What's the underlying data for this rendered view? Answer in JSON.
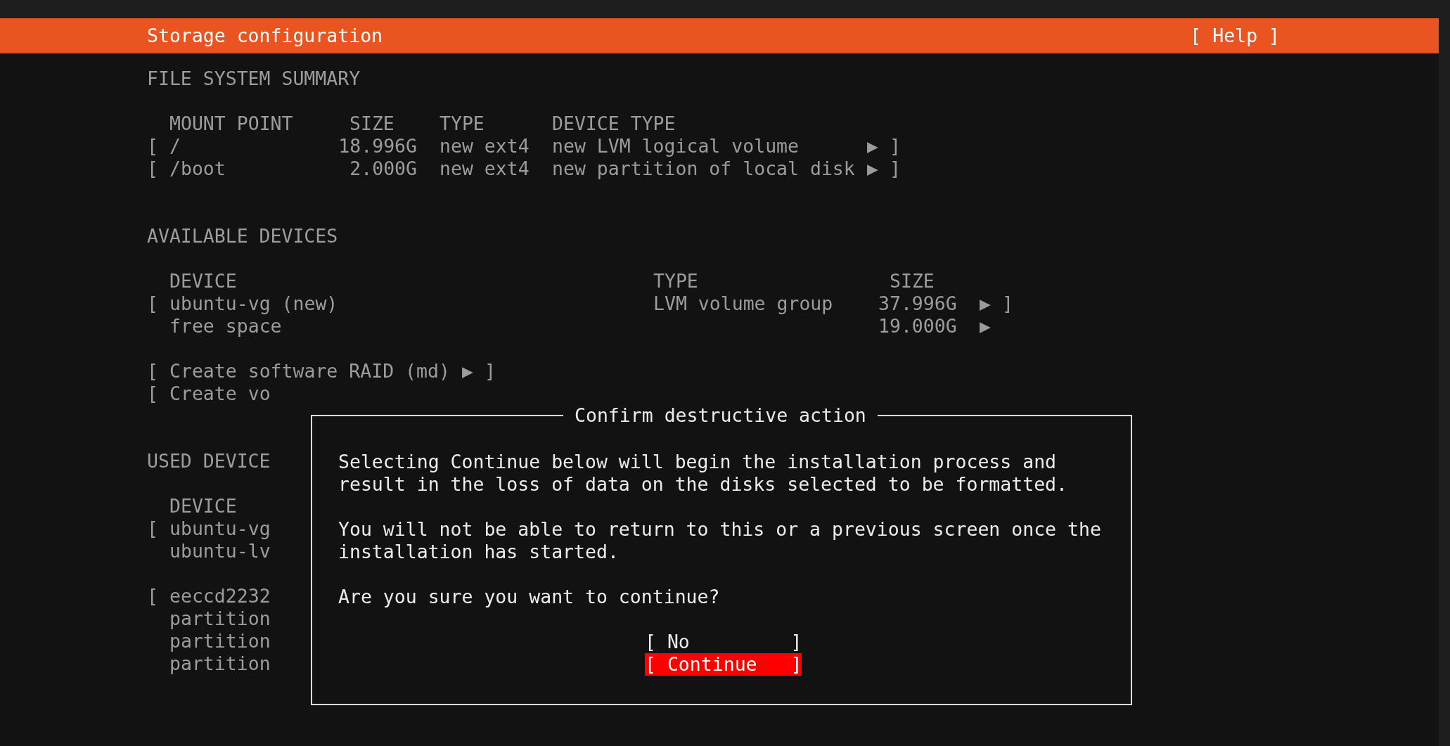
{
  "header": {
    "title": "Storage configuration",
    "help": "[ Help ]"
  },
  "file_system_summary": {
    "heading": "FILE SYSTEM SUMMARY",
    "columns": [
      "MOUNT POINT",
      "SIZE",
      "TYPE",
      "DEVICE TYPE"
    ],
    "rows": [
      {
        "open": "[",
        "mount_point": "/",
        "size": "18.996G",
        "type": "new ext4",
        "device_type": "new LVM logical volume",
        "arrow": "▶",
        "close": "]"
      },
      {
        "open": "[",
        "mount_point": "/boot",
        "size": "2.000G",
        "type": "new ext4",
        "device_type": "new partition of local disk",
        "arrow": "▶",
        "close": "]"
      }
    ]
  },
  "available_devices": {
    "heading": "AVAILABLE DEVICES",
    "columns": [
      "DEVICE",
      "TYPE",
      "SIZE"
    ],
    "rows": [
      {
        "open": "[",
        "device": "ubuntu-vg (new)",
        "type": "LVM volume group",
        "size": "37.996G",
        "arrow": "▶",
        "close": "]"
      },
      {
        "device": "free space",
        "size": "19.000G",
        "arrow": "▶"
      }
    ],
    "actions": [
      {
        "open": "[",
        "label": "Create software RAID (md)",
        "arrow": "▶",
        "close": "]"
      },
      {
        "open": "[",
        "label": "Create vo"
      }
    ]
  },
  "used_devices": {
    "heading": "USED DEVICE",
    "columns": [
      "DEVICE"
    ],
    "groups": [
      [
        {
          "open": "[",
          "device": "ubuntu-vg"
        },
        {
          "device": "ubuntu-lv"
        }
      ],
      [
        {
          "open": "[",
          "device": "eeccd2232"
        },
        {
          "device": "partition"
        },
        {
          "device": "partition"
        },
        {
          "device": "partition"
        }
      ]
    ]
  },
  "dialog": {
    "title": "Confirm destructive action",
    "paragraphs": [
      "Selecting Continue below will begin the installation process and result in the loss of data on the disks selected to be formatted.",
      "You will not be able to return to this or a previous screen once the installation has started.",
      "Are you sure you want to continue?"
    ],
    "buttons": [
      {
        "label": "[ No         ]",
        "selected": false
      },
      {
        "label": "[ Continue   ]",
        "selected": true
      }
    ]
  }
}
